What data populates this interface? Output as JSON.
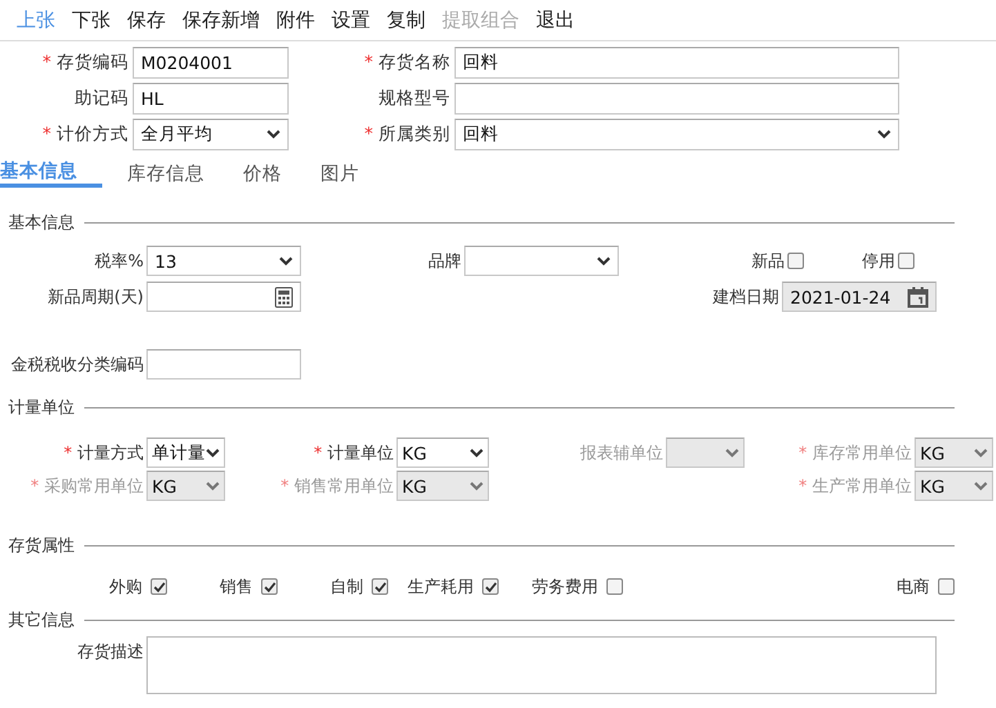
{
  "toolbar": [
    {
      "label": "上张",
      "active": true,
      "disabled": false
    },
    {
      "label": "下张",
      "active": false,
      "disabled": false
    },
    {
      "label": "保存",
      "active": false,
      "disabled": false
    },
    {
      "label": "保存新增",
      "active": false,
      "disabled": false
    },
    {
      "label": "附件",
      "active": false,
      "disabled": false
    },
    {
      "label": "设置",
      "active": false,
      "disabled": false
    },
    {
      "label": "复制",
      "active": false,
      "disabled": false
    },
    {
      "label": "提取组合",
      "active": false,
      "disabled": true
    },
    {
      "label": "退出",
      "active": false,
      "disabled": false
    }
  ],
  "header": {
    "fields": [
      {
        "label": "存货编码",
        "required_mark": "*",
        "kind": "text",
        "value": "M0204001"
      },
      {
        "label": "存货名称",
        "required_mark": "*",
        "kind": "text",
        "value": "回料"
      },
      {
        "label": "助记码",
        "kind": "text",
        "value": "HL"
      },
      {
        "label": "规格型号",
        "kind": "text"
      },
      {
        "label": "计价方式",
        "required_mark": "*",
        "kind": "select",
        "value": "全月平均"
      },
      {
        "label": "所属类别",
        "required_mark": "*",
        "kind": "select",
        "value": "回料"
      }
    ]
  },
  "tabs": [
    {
      "label": "基本信息",
      "selected": true
    },
    {
      "label": "库存信息",
      "selected": false
    },
    {
      "label": "价格",
      "selected": false
    },
    {
      "label": "图片",
      "selected": false
    }
  ],
  "basic_info": {
    "title": "基本信息",
    "tax_rate": {
      "label": "税率%",
      "value": "13"
    },
    "brand": {
      "label": "品牌"
    },
    "new_product": {
      "label": "新品",
      "checked": false
    },
    "discontinued": {
      "label": "停用",
      "checked": false
    },
    "new_period": {
      "label": "新品周期(天)"
    },
    "created_date": {
      "label": "建档日期",
      "value": "2021-01-24"
    },
    "tax_code": {
      "label": "金税税收分类编码"
    }
  },
  "units": {
    "title": "计量单位",
    "fields": [
      {
        "label": "计量方式",
        "required_mark": "*",
        "disabled": false,
        "value": "单计量"
      },
      {
        "label": "计量单位",
        "required_mark": "*",
        "disabled": false,
        "value": "KG"
      },
      {
        "label": "报表辅单位",
        "disabled": true
      },
      {
        "label": "库存常用单位",
        "required_mark": "*",
        "disabled": true,
        "value": "KG"
      },
      {
        "label": "采购常用单位",
        "required_mark": "*",
        "disabled": true,
        "value": "KG"
      },
      {
        "label": "销售常用单位",
        "required_mark": "*",
        "disabled": true,
        "value": "KG"
      },
      {
        "label": "生产常用单位",
        "required_mark": "*",
        "disabled": true,
        "value": "KG"
      }
    ]
  },
  "attributes": {
    "title": "存货属性",
    "items": [
      {
        "label": "外购",
        "checked": true
      },
      {
        "label": "销售",
        "checked": true
      },
      {
        "label": "自制",
        "checked": true
      },
      {
        "label": "生产耗用",
        "checked": true
      },
      {
        "label": "劳务费用",
        "checked": false
      },
      {
        "label": "电商",
        "checked": false
      }
    ]
  },
  "other": {
    "title": "其它信息",
    "description": {
      "label": "存货描述"
    }
  }
}
